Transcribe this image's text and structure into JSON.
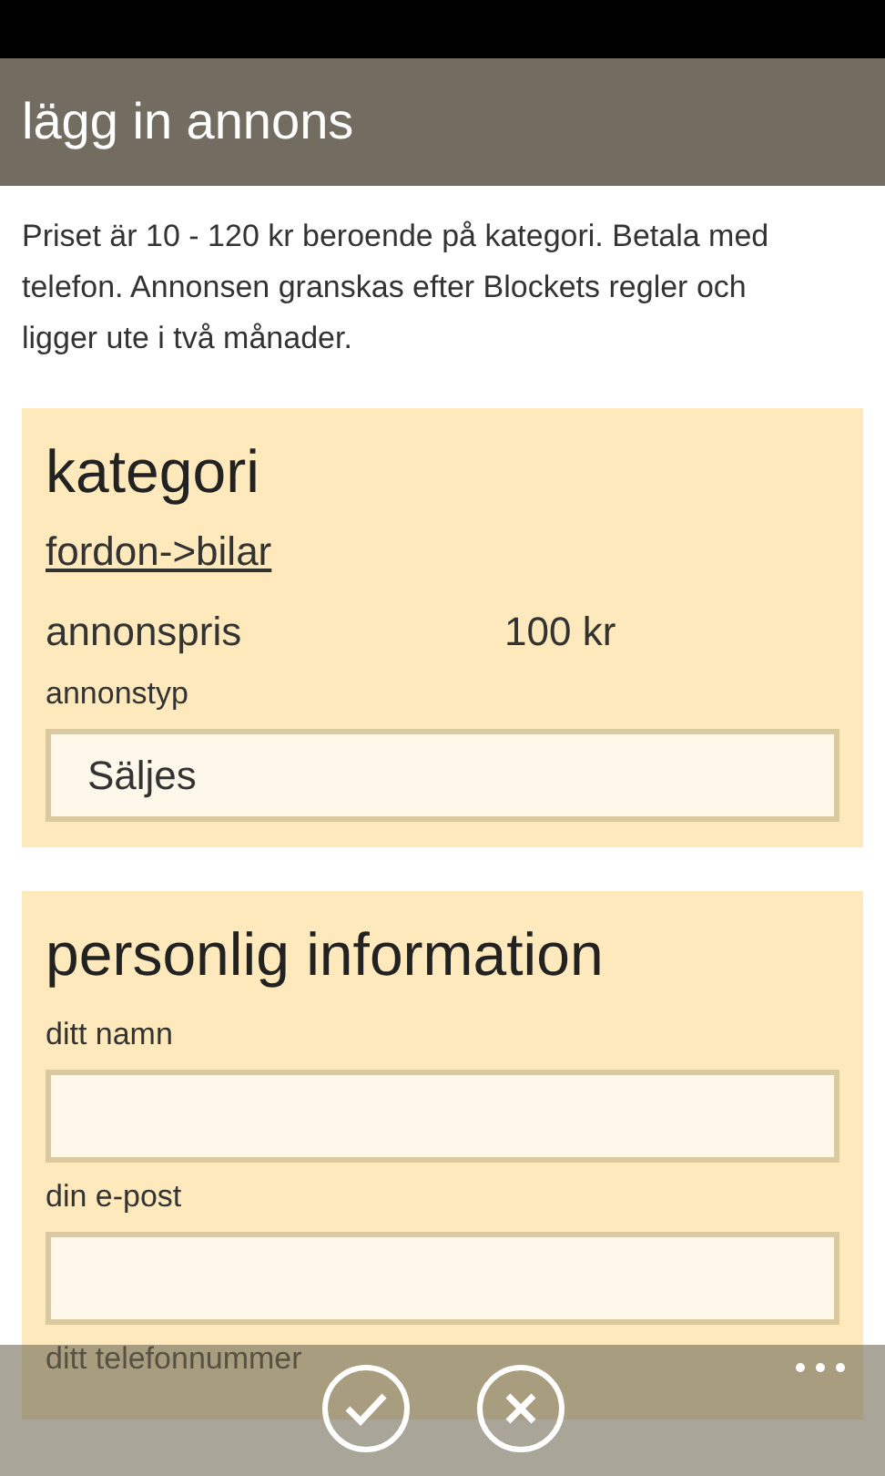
{
  "header": {
    "title": "lägg in annons"
  },
  "intro": "Priset är 10 - 120 kr beroende på kategori. Betala med telefon. Annonsen granskas efter Blockets regler och ligger ute i två månader.",
  "category_card": {
    "title": "kategori",
    "category_link": "fordon->bilar",
    "price_label": "annonspris",
    "price_value": "100 kr",
    "type_label": "annonstyp",
    "type_value": "Säljes"
  },
  "personal_card": {
    "title": "personlig information",
    "fields": [
      {
        "label": "ditt namn"
      },
      {
        "label": "din e-post"
      },
      {
        "label": "ditt telefonnummer"
      }
    ]
  },
  "app_bar": {
    "buttons": [
      {
        "kind": "confirm"
      },
      {
        "kind": "cancel"
      }
    ]
  }
}
